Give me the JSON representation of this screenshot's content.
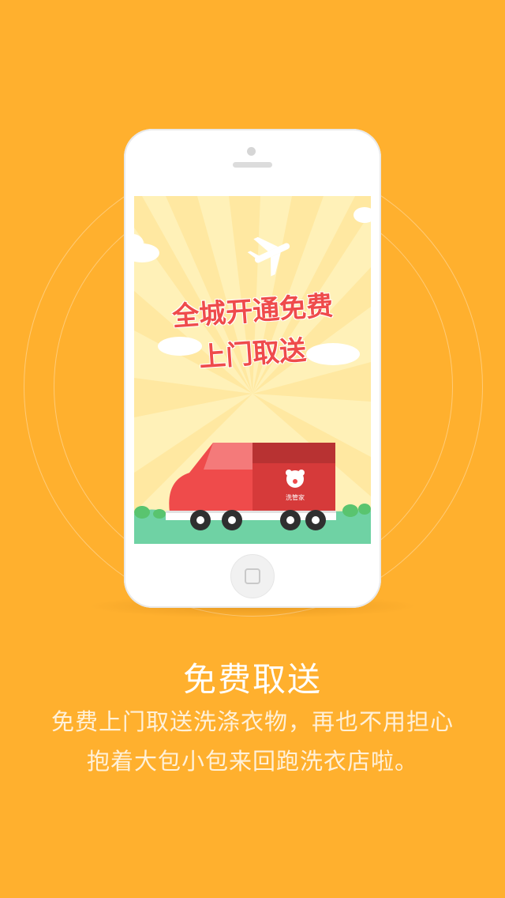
{
  "colors": {
    "background": "#FFB02E",
    "truck": "#EF4B4B",
    "ground": "#6FD2A4"
  },
  "screen": {
    "slogan_line1": "全城开通免费",
    "slogan_line2": "上门取送",
    "truck_logo_text": "洗管家"
  },
  "feature": {
    "title": "免费取送",
    "description_line1": "免费上门取送洗涤衣物，再也不用担心",
    "description_line2": "抱着大包小包来回跑洗衣店啦。"
  },
  "icons": [
    "airplane-icon",
    "bear-logo-icon",
    "home-button-icon"
  ]
}
